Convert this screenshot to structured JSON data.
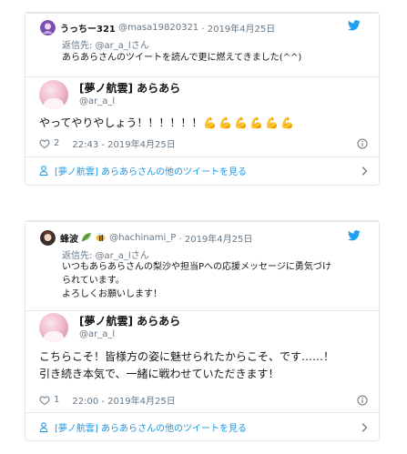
{
  "colors": {
    "link": "#1b95e0",
    "muted": "#657786",
    "text": "#14171a",
    "border": "#e1e8ed",
    "twitter": "#1da1f2",
    "heart": "#657786"
  },
  "tweets": [
    {
      "quoted": {
        "name": "うっちー321",
        "handle": "@masa19820321",
        "date": "· 2019年4月25日",
        "reply_to": "返信先: @ar_a_lさん",
        "text": [
          "あらあらさんのツイートを読んで更に燃えてきました(^^)"
        ]
      },
      "author": {
        "name": "[夢ノ航雲] あらあら",
        "handle": "@ar_a_l"
      },
      "body": [
        "やってやりやしょう！！！！！！"
      ],
      "emoji_count": 6,
      "likes": "2",
      "timestamp": "22:43 - 2019年4月25日",
      "footer": "[夢ノ航雲] あらあらさんの他のツイートを見る"
    },
    {
      "quoted": {
        "name": "蜂波",
        "handle": "@hachinami_P",
        "date": "· 2019年4月25日",
        "reply_to": "返信先: @ar_a_lさん",
        "text": [
          "いつもあらあらさんの梨沙や担当Pへの応援メッセージに勇気づけ",
          "られています。",
          "よろしくお願いします！"
        ]
      },
      "author": {
        "name": "[夢ノ航雲] あらあら",
        "handle": "@ar_a_l"
      },
      "body": [
        "こちらこそ！皆様方の姿に魅せられたからこそ、です……！",
        "引き続き本気で、一緒に戦わせていただきます！"
      ],
      "likes": "1",
      "timestamp": "22:00 - 2019年4月25日",
      "footer": "[夢ノ航雲] あらあらさんの他のツイートを見る"
    }
  ],
  "icons": {
    "bird": "twitter-bird-icon",
    "heart": "heart-icon",
    "info": "info-icon",
    "person": "person-icon",
    "chevron": "chevron-right-icon",
    "strong": "flexed-biceps-emoji",
    "leaf": "leaf-emoji",
    "bee": "bee-emoji"
  }
}
